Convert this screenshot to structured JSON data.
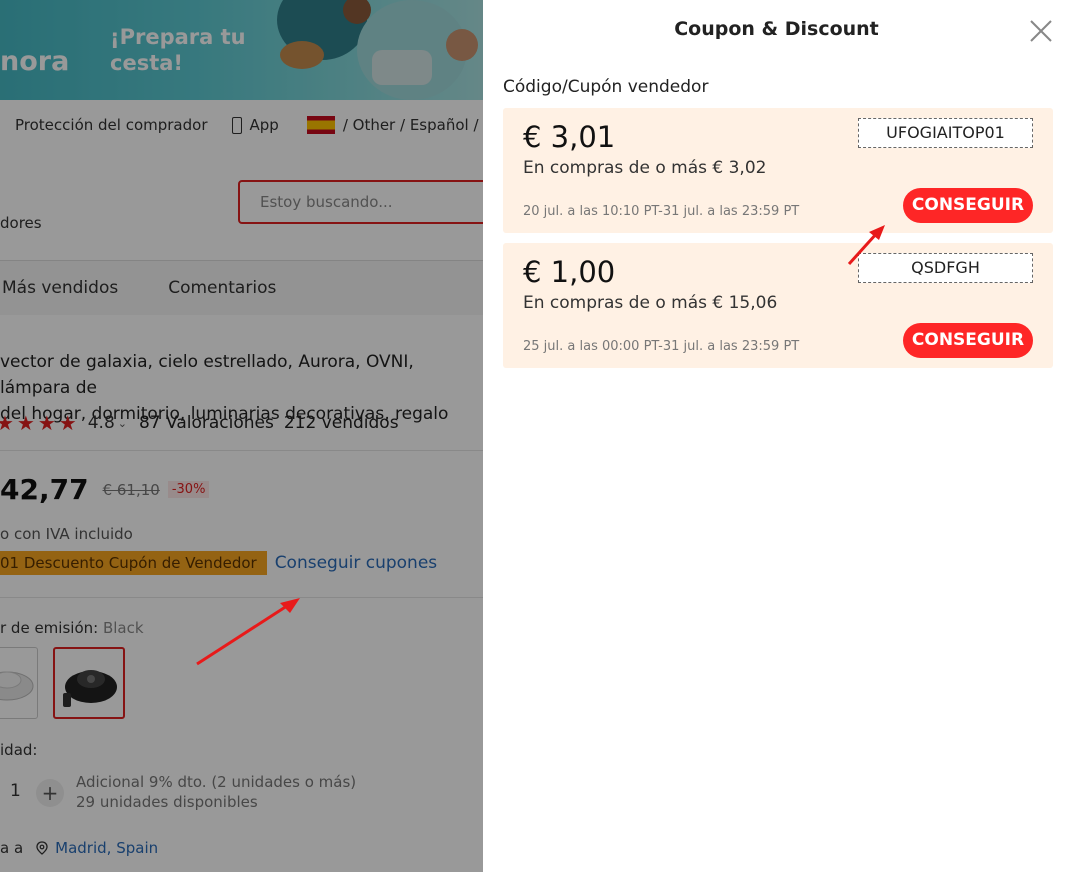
{
  "background": {
    "banner": {
      "brand": "nora",
      "text": "¡Prepara tu\ncesta!"
    },
    "nav": {
      "buyer_protection": "Protección del comprador",
      "app": "App",
      "locale": "/ Other / Español / E"
    },
    "search": {
      "placeholder": "Estoy buscando..."
    },
    "sellers_text": "dores",
    "tabs": [
      "Más vendidos",
      "Comentarios"
    ],
    "product": {
      "title": "vector de galaxia, cielo estrellado, Aurora, OVNI, lámpara de\n del hogar, dormitorio, luminarias decorativas, regalo",
      "stars": "★★★★",
      "rating": "4.8",
      "rating_count": "87 Valoraciones",
      "sold": "212 vendidos",
      "price": "42,77",
      "old_price": "€ 61,10",
      "discount": "-30%",
      "tax_note": "o con IVA incluido",
      "coupon_tag": "01 Descuento Cupón de Vendedor",
      "get_coupons": "Conseguir cupones",
      "color_label": "r de emisión: ",
      "color_value": "Black",
      "quantity_label": "idad:",
      "quantity": "1",
      "quantity_note_1": "Adicional 9% dto. (2 unidades o más)",
      "quantity_note_2": "29 unidades disponibles",
      "ship_prefix": "a a",
      "ship_location": "Madrid, Spain"
    }
  },
  "drawer": {
    "title": "Coupon & Discount",
    "section_title": "Código/Cupón vendedor",
    "coupons": [
      {
        "amount": "€ 3,01",
        "condition": "En compras de o más € 3,02",
        "validity": "20 jul. a las 10:10 PT-31 jul. a las 23:59 PT",
        "code": "UFOGIAITOP01",
        "button": "CONSEGUIR"
      },
      {
        "amount": "€ 1,00",
        "condition": "En compras de o más € 15,06",
        "validity": "25 jul. a las 00:00 PT-31 jul. a las 23:59 PT",
        "code": "QSDFGH",
        "button": "CONSEGUIR"
      }
    ]
  },
  "colors": {
    "accent_red": "#fe2626",
    "coupon_bg": "#fff1e4",
    "link_blue": "#2a6bb8",
    "coupon_tag": "#f7a521"
  },
  "icons": [
    "phone-icon",
    "spain-flag-icon",
    "star-icon",
    "plus-icon",
    "location-pin-icon",
    "close-icon",
    "arrow-annotation-icon"
  ]
}
